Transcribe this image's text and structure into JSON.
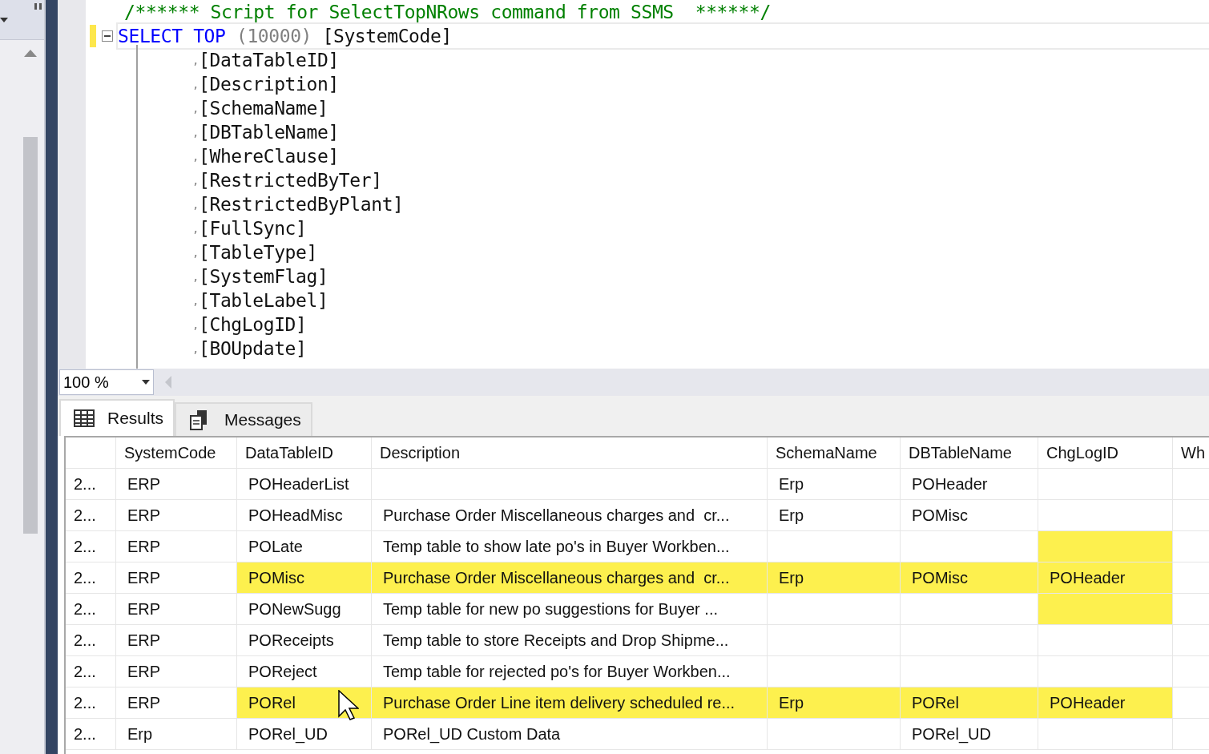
{
  "editor": {
    "lines": [
      {
        "kind": "comment",
        "text": "/****** Script for SelectTopNRows command from SSMS  ******/"
      },
      {
        "kind": "select",
        "changed": true,
        "keywords": [
          "SELECT",
          "TOP"
        ],
        "argument": "(10000)",
        "column": "[SystemCode]"
      },
      {
        "kind": "column",
        "comma": ",",
        "text": "[DataTableID]"
      },
      {
        "kind": "column",
        "comma": ",",
        "text": "[Description]"
      },
      {
        "kind": "column",
        "comma": ",",
        "text": "[SchemaName]"
      },
      {
        "kind": "column",
        "comma": ",",
        "text": "[DBTableName]"
      },
      {
        "kind": "column",
        "comma": ",",
        "text": "[WhereClause]"
      },
      {
        "kind": "column",
        "comma": ",",
        "text": "[RestrictedByTer]"
      },
      {
        "kind": "column",
        "comma": ",",
        "text": "[RestrictedByPlant]"
      },
      {
        "kind": "column",
        "comma": ",",
        "text": "[FullSync]"
      },
      {
        "kind": "column",
        "comma": ",",
        "text": "[TableType]"
      },
      {
        "kind": "column",
        "comma": ",",
        "text": "[SystemFlag]"
      },
      {
        "kind": "column",
        "comma": ",",
        "text": "[TableLabel]"
      },
      {
        "kind": "column",
        "comma": ",",
        "text": "[ChgLogID]"
      },
      {
        "kind": "column",
        "comma": ",",
        "text": "[BOUpdate]"
      }
    ],
    "zoom": "100 %"
  },
  "tabs": [
    {
      "label": "Results",
      "selected": true
    },
    {
      "label": "Messages",
      "selected": false
    }
  ],
  "grid": {
    "columns": [
      "SystemCode",
      "DataTableID",
      "Description",
      "SchemaName",
      "DBTableName",
      "ChgLogID",
      "Wh"
    ],
    "rows": [
      {
        "row_header": "2...",
        "cells": [
          {
            "text": "ERP",
            "highlighted": false
          },
          {
            "text": "POHeaderList",
            "highlighted": false
          },
          {
            "highlighted": false
          },
          {
            "text": "Erp",
            "highlighted": false
          },
          {
            "text": "POHeader",
            "highlighted": false
          },
          {
            "highlighted": false
          },
          {
            "highlighted": false
          }
        ]
      },
      {
        "row_header": "2...",
        "cells": [
          {
            "text": "ERP",
            "highlighted": false
          },
          {
            "text": "POHeadMisc",
            "highlighted": false
          },
          {
            "text": "Purchase Order Miscellaneous charges and  cr...",
            "highlighted": false
          },
          {
            "text": "Erp",
            "highlighted": false
          },
          {
            "text": "POMisc",
            "highlighted": false
          },
          {
            "highlighted": false
          },
          {
            "highlighted": false
          }
        ]
      },
      {
        "row_header": "2...",
        "cells": [
          {
            "text": "ERP",
            "highlighted": false
          },
          {
            "text": "POLate",
            "highlighted": false
          },
          {
            "text": "Temp table to show late po's in Buyer Workben...",
            "highlighted": false
          },
          {
            "highlighted": false
          },
          {
            "highlighted": false
          },
          {
            "highlighted": true
          },
          {
            "highlighted": false
          }
        ]
      },
      {
        "row_header": "2...",
        "cells": [
          {
            "text": "ERP",
            "highlighted": false
          },
          {
            "text": "POMisc",
            "highlighted": true
          },
          {
            "text": "Purchase Order Miscellaneous charges and  cr...",
            "highlighted": true
          },
          {
            "text": "Erp",
            "highlighted": true
          },
          {
            "text": "POMisc",
            "highlighted": true
          },
          {
            "text": "POHeader",
            "highlighted": true
          },
          {
            "highlighted": false
          }
        ]
      },
      {
        "row_header": "2...",
        "cells": [
          {
            "text": "ERP",
            "highlighted": false
          },
          {
            "text": "PONewSugg",
            "highlighted": false
          },
          {
            "text": "Temp table for new po suggestions for Buyer ...",
            "highlighted": false
          },
          {
            "highlighted": false
          },
          {
            "highlighted": false
          },
          {
            "highlighted": true
          },
          {
            "highlighted": false
          }
        ]
      },
      {
        "row_header": "2...",
        "cells": [
          {
            "text": "ERP",
            "highlighted": false
          },
          {
            "text": "POReceipts",
            "highlighted": false
          },
          {
            "text": "Temp table to store Receipts and Drop Shipme...",
            "highlighted": false
          },
          {
            "highlighted": false
          },
          {
            "highlighted": false
          },
          {
            "highlighted": false
          },
          {
            "highlighted": false
          }
        ]
      },
      {
        "row_header": "2...",
        "cells": [
          {
            "text": "ERP",
            "highlighted": false
          },
          {
            "text": "POReject",
            "highlighted": false
          },
          {
            "text": "Temp table for rejected po's for Buyer Workben...",
            "highlighted": false
          },
          {
            "highlighted": false
          },
          {
            "highlighted": false
          },
          {
            "highlighted": false
          },
          {
            "highlighted": false
          }
        ]
      },
      {
        "row_header": "2...",
        "cells": [
          {
            "text": "ERP",
            "highlighted": false
          },
          {
            "text": "PORel",
            "highlighted": true
          },
          {
            "text": "Purchase Order Line item delivery scheduled re...",
            "highlighted": true
          },
          {
            "text": "Erp",
            "highlighted": true
          },
          {
            "text": "PORel",
            "highlighted": true
          },
          {
            "text": "POHeader",
            "highlighted": true
          },
          {
            "highlighted": false
          }
        ]
      },
      {
        "row_header": "2...",
        "cells": [
          {
            "text": "Erp",
            "highlighted": false
          },
          {
            "text": "PORel_UD",
            "highlighted": false
          },
          {
            "text": "PORel_UD Custom Data",
            "highlighted": false
          },
          {
            "highlighted": false
          },
          {
            "text": "PORel_UD",
            "highlighted": false
          },
          {
            "highlighted": false
          },
          {
            "highlighted": false
          }
        ]
      }
    ]
  }
}
